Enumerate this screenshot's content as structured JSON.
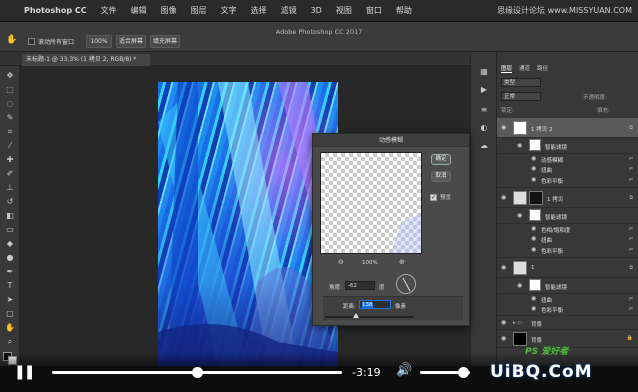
{
  "menubar": {
    "app_name": "Photoshop CC",
    "items": [
      "文件",
      "编辑",
      "图像",
      "图层",
      "文字",
      "选择",
      "滤镜",
      "3D",
      "视图",
      "窗口",
      "帮助"
    ],
    "watermark": "思缘设计论坛 www.MISSYUAN.COM"
  },
  "options": {
    "window_title": "Adobe Photoshop CC 2017",
    "scroll_all_label": "滚动所有窗口",
    "zoom_value": "100%",
    "fit_screen": "适合屏幕",
    "fill_screen": "填充屏幕"
  },
  "document": {
    "tab_label": "未标题-1 @ 33.3% (1 拷贝 2, RGB/8) *"
  },
  "dialog": {
    "title": "动感模糊",
    "ok_label": "确定",
    "cancel_label": "取消",
    "preview_label": "预览",
    "preview_checked": true,
    "zoom_value": "100%",
    "angle_label": "角度:",
    "angle_value": "-62",
    "angle_unit": "度",
    "distance_label": "距离:",
    "distance_value": "138",
    "distance_unit": "像素"
  },
  "layers_panel": {
    "tabs": [
      "图层",
      "通道",
      "路径"
    ],
    "kind_label": "类型",
    "blend_mode": "正常",
    "opacity_label": "不透明度:",
    "fill_label": "填充:",
    "lock_label": "锁定:",
    "rows": [
      {
        "kind": "layer",
        "label": "1 拷贝 2",
        "selected": true
      },
      {
        "kind": "smart",
        "label": "智能滤镜"
      },
      {
        "kind": "filter",
        "label": "动感模糊"
      },
      {
        "kind": "filter",
        "label": "扭曲"
      },
      {
        "kind": "filter",
        "label": "色彩平衡"
      },
      {
        "kind": "layer",
        "label": "1 拷贝"
      },
      {
        "kind": "smart",
        "label": "智能滤镜"
      },
      {
        "kind": "filter",
        "label": "色相/饱和度"
      },
      {
        "kind": "filter",
        "label": "扭曲"
      },
      {
        "kind": "filter",
        "label": "色彩平衡"
      },
      {
        "kind": "layer",
        "label": "1"
      },
      {
        "kind": "smart",
        "label": "智能滤镜"
      },
      {
        "kind": "filter",
        "label": "扭曲"
      },
      {
        "kind": "filter",
        "label": "色彩平衡"
      },
      {
        "kind": "group",
        "label": "背景"
      },
      {
        "kind": "bg",
        "label": "背景"
      }
    ]
  },
  "video": {
    "time_remaining": "-3:19",
    "progress_fraction": 0.5,
    "volume_fraction": 0.85,
    "brand": "UiBQ.CoM",
    "ps_badge": "PS 爱好者"
  },
  "colors": {
    "accent": "#1473e6",
    "panel": "#383838",
    "canvas_bg": "#282828"
  }
}
